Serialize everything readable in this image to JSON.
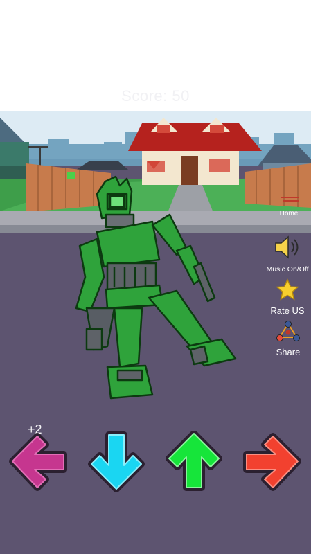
{
  "hud": {
    "score_text": "Score: 50",
    "combo_text": "+2"
  },
  "side_menu": {
    "home_label": "Home",
    "music_label": "Music On/Off",
    "rate_label": "Rate US",
    "share_label": "Share"
  },
  "arrows": [
    {
      "direction": "left",
      "color": "#c6368f"
    },
    {
      "direction": "down",
      "color": "#1ad6f2"
    },
    {
      "direction": "up",
      "color": "#16e53a"
    },
    {
      "direction": "right",
      "color": "#f2412f"
    }
  ],
  "icons": [
    "speaker-icon",
    "star-icon",
    "share-icon",
    "home-icon"
  ]
}
